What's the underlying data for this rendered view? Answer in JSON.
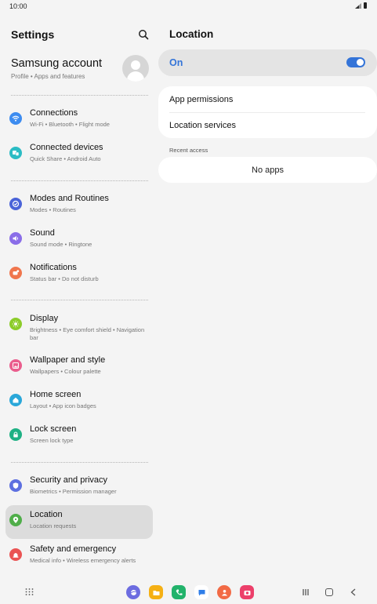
{
  "status": {
    "time": "10:00"
  },
  "left": {
    "title": "Settings",
    "account": {
      "name": "Samsung account",
      "sub": "Profile  •  Apps and features"
    },
    "items": [
      {
        "label": "Connections",
        "sub": "Wi-Fi  •  Bluetooth  •  Flight mode",
        "icon": "wifi-icon",
        "color": "#3d8cf0"
      },
      {
        "label": "Connected devices",
        "sub": "Quick Share  •  Android Auto",
        "icon": "devices-icon",
        "color": "#2bbcc4"
      },
      {
        "label": "Modes and Routines",
        "sub": "Modes  •  Routines",
        "icon": "routines-icon",
        "color": "#4a63d8"
      },
      {
        "label": "Sound",
        "sub": "Sound mode  •  Ringtone",
        "icon": "speaker-icon",
        "color": "#8a6de8"
      },
      {
        "label": "Notifications",
        "sub": "Status bar  •  Do not disturb",
        "icon": "bell-icon",
        "color": "#f0764d"
      },
      {
        "label": "Display",
        "sub": "Brightness  •  Eye comfort shield  •  Navigation bar",
        "icon": "sun-icon",
        "color": "#8ccc2a"
      },
      {
        "label": "Wallpaper and style",
        "sub": "Wallpapers  •  Colour palette",
        "icon": "wallpaper-icon",
        "color": "#ea5d8d"
      },
      {
        "label": "Home screen",
        "sub": "Layout  •  App icon badges",
        "icon": "home-icon",
        "color": "#2aa7d9"
      },
      {
        "label": "Lock screen",
        "sub": "Screen lock type",
        "icon": "lock-icon",
        "color": "#1fb184"
      },
      {
        "label": "Security and privacy",
        "sub": "Biometrics  •  Permission manager",
        "icon": "shield-icon",
        "color": "#5d6fe0"
      },
      {
        "label": "Location",
        "sub": "Location requests",
        "icon": "location-pin-icon",
        "color": "#4fae49"
      },
      {
        "label": "Safety and emergency",
        "sub": "Medical info  •  Wireless emergency alerts",
        "icon": "emergency-icon",
        "color": "#ea5353"
      }
    ]
  },
  "right": {
    "title": "Location",
    "toggle_label": "On",
    "toggle_on": true,
    "rows": [
      "App permissions",
      "Location services"
    ],
    "recent_label": "Recent access",
    "no_apps": "No apps"
  },
  "colors": {
    "accent": "#3474d8",
    "background": "#f4f4f4",
    "selected": "#dcdcdc"
  }
}
